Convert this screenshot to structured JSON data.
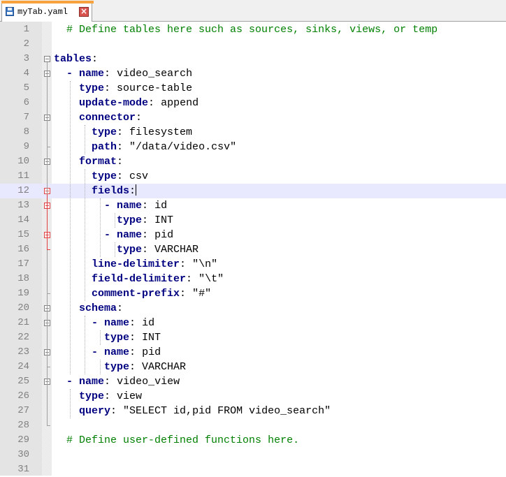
{
  "tab": {
    "title": "myTab.yaml",
    "close_glyph": "×",
    "icon": "save-disk-icon"
  },
  "editor": {
    "current_line": 12,
    "lines": [
      {
        "n": "1",
        "segs": [
          {
            "t": "  ",
            "c": "v"
          },
          {
            "t": "# Define tables here such as sources, sinks, views, or temp",
            "c": "c"
          }
        ]
      },
      {
        "n": "2",
        "segs": []
      },
      {
        "n": "3",
        "segs": [
          {
            "t": "tables",
            "c": "k"
          },
          {
            "t": ":",
            "c": "p"
          }
        ]
      },
      {
        "n": "4",
        "segs": [
          {
            "t": "  ",
            "c": "v"
          },
          {
            "t": "- ",
            "c": "d"
          },
          {
            "t": "name",
            "c": "k"
          },
          {
            "t": ": ",
            "c": "p"
          },
          {
            "t": "video_search",
            "c": "v"
          }
        ]
      },
      {
        "n": "5",
        "segs": [
          {
            "t": "    ",
            "c": "v"
          },
          {
            "t": "type",
            "c": "k"
          },
          {
            "t": ": ",
            "c": "p"
          },
          {
            "t": "source-table",
            "c": "v"
          }
        ]
      },
      {
        "n": "6",
        "segs": [
          {
            "t": "    ",
            "c": "v"
          },
          {
            "t": "update-mode",
            "c": "k"
          },
          {
            "t": ": ",
            "c": "p"
          },
          {
            "t": "append",
            "c": "v"
          }
        ]
      },
      {
        "n": "7",
        "segs": [
          {
            "t": "    ",
            "c": "v"
          },
          {
            "t": "connector",
            "c": "k"
          },
          {
            "t": ":",
            "c": "p"
          }
        ]
      },
      {
        "n": "8",
        "segs": [
          {
            "t": "      ",
            "c": "v"
          },
          {
            "t": "type",
            "c": "k"
          },
          {
            "t": ": ",
            "c": "p"
          },
          {
            "t": "filesystem",
            "c": "v"
          }
        ]
      },
      {
        "n": "9",
        "segs": [
          {
            "t": "      ",
            "c": "v"
          },
          {
            "t": "path",
            "c": "k"
          },
          {
            "t": ": ",
            "c": "p"
          },
          {
            "t": "\"/data/video.csv\"",
            "c": "v"
          }
        ]
      },
      {
        "n": "10",
        "segs": [
          {
            "t": "    ",
            "c": "v"
          },
          {
            "t": "format",
            "c": "k"
          },
          {
            "t": ":",
            "c": "p"
          }
        ]
      },
      {
        "n": "11",
        "segs": [
          {
            "t": "      ",
            "c": "v"
          },
          {
            "t": "type",
            "c": "k"
          },
          {
            "t": ": ",
            "c": "p"
          },
          {
            "t": "csv",
            "c": "v"
          }
        ]
      },
      {
        "n": "12",
        "segs": [
          {
            "t": "      ",
            "c": "v"
          },
          {
            "t": "fields",
            "c": "k"
          },
          {
            "t": ":",
            "c": "p"
          }
        ],
        "caret": true
      },
      {
        "n": "13",
        "segs": [
          {
            "t": "        ",
            "c": "v"
          },
          {
            "t": "- ",
            "c": "d"
          },
          {
            "t": "name",
            "c": "k"
          },
          {
            "t": ": ",
            "c": "p"
          },
          {
            "t": "id",
            "c": "v"
          }
        ]
      },
      {
        "n": "14",
        "segs": [
          {
            "t": "          ",
            "c": "v"
          },
          {
            "t": "type",
            "c": "k"
          },
          {
            "t": ": ",
            "c": "p"
          },
          {
            "t": "INT",
            "c": "v"
          }
        ]
      },
      {
        "n": "15",
        "segs": [
          {
            "t": "        ",
            "c": "v"
          },
          {
            "t": "- ",
            "c": "d"
          },
          {
            "t": "name",
            "c": "k"
          },
          {
            "t": ": ",
            "c": "p"
          },
          {
            "t": "pid",
            "c": "v"
          }
        ]
      },
      {
        "n": "16",
        "segs": [
          {
            "t": "          ",
            "c": "v"
          },
          {
            "t": "type",
            "c": "k"
          },
          {
            "t": ": ",
            "c": "p"
          },
          {
            "t": "VARCHAR",
            "c": "v"
          }
        ]
      },
      {
        "n": "17",
        "segs": [
          {
            "t": "      ",
            "c": "v"
          },
          {
            "t": "line-delimiter",
            "c": "k"
          },
          {
            "t": ": ",
            "c": "p"
          },
          {
            "t": "\"\\n\"",
            "c": "v"
          }
        ]
      },
      {
        "n": "18",
        "segs": [
          {
            "t": "      ",
            "c": "v"
          },
          {
            "t": "field-delimiter",
            "c": "k"
          },
          {
            "t": ": ",
            "c": "p"
          },
          {
            "t": "\"\\t\"",
            "c": "v"
          }
        ]
      },
      {
        "n": "19",
        "segs": [
          {
            "t": "      ",
            "c": "v"
          },
          {
            "t": "comment-prefix",
            "c": "k"
          },
          {
            "t": ": ",
            "c": "p"
          },
          {
            "t": "\"#\"",
            "c": "v"
          }
        ]
      },
      {
        "n": "20",
        "segs": [
          {
            "t": "    ",
            "c": "v"
          },
          {
            "t": "schema",
            "c": "k"
          },
          {
            "t": ":",
            "c": "p"
          }
        ]
      },
      {
        "n": "21",
        "segs": [
          {
            "t": "      ",
            "c": "v"
          },
          {
            "t": "- ",
            "c": "d"
          },
          {
            "t": "name",
            "c": "k"
          },
          {
            "t": ": ",
            "c": "p"
          },
          {
            "t": "id",
            "c": "v"
          }
        ]
      },
      {
        "n": "22",
        "segs": [
          {
            "t": "        ",
            "c": "v"
          },
          {
            "t": "type",
            "c": "k"
          },
          {
            "t": ": ",
            "c": "p"
          },
          {
            "t": "INT",
            "c": "v"
          }
        ]
      },
      {
        "n": "23",
        "segs": [
          {
            "t": "      ",
            "c": "v"
          },
          {
            "t": "- ",
            "c": "d"
          },
          {
            "t": "name",
            "c": "k"
          },
          {
            "t": ": ",
            "c": "p"
          },
          {
            "t": "pid",
            "c": "v"
          }
        ]
      },
      {
        "n": "24",
        "segs": [
          {
            "t": "        ",
            "c": "v"
          },
          {
            "t": "type",
            "c": "k"
          },
          {
            "t": ": ",
            "c": "p"
          },
          {
            "t": "VARCHAR",
            "c": "v"
          }
        ]
      },
      {
        "n": "25",
        "segs": [
          {
            "t": "  ",
            "c": "v"
          },
          {
            "t": "- ",
            "c": "d"
          },
          {
            "t": "name",
            "c": "k"
          },
          {
            "t": ": ",
            "c": "p"
          },
          {
            "t": "video_view",
            "c": "v"
          }
        ]
      },
      {
        "n": "26",
        "segs": [
          {
            "t": "    ",
            "c": "v"
          },
          {
            "t": "type",
            "c": "k"
          },
          {
            "t": ": ",
            "c": "p"
          },
          {
            "t": "view",
            "c": "v"
          }
        ]
      },
      {
        "n": "27",
        "segs": [
          {
            "t": "    ",
            "c": "v"
          },
          {
            "t": "query",
            "c": "k"
          },
          {
            "t": ": ",
            "c": "p"
          },
          {
            "t": "\"SELECT id,pid FROM video_search\"",
            "c": "v"
          }
        ]
      },
      {
        "n": "28",
        "segs": []
      },
      {
        "n": "29",
        "segs": [
          {
            "t": "  ",
            "c": "v"
          },
          {
            "t": "# Define user-defined functions here.",
            "c": "c"
          }
        ]
      },
      {
        "n": "30",
        "segs": []
      },
      {
        "n": "31",
        "segs": []
      }
    ]
  },
  "colors": {
    "comment": "#008000",
    "key": "#000080",
    "current_line": "#e8e8ff",
    "gutter": "#e4e4e4",
    "tab_accent": "#f7a23c"
  }
}
